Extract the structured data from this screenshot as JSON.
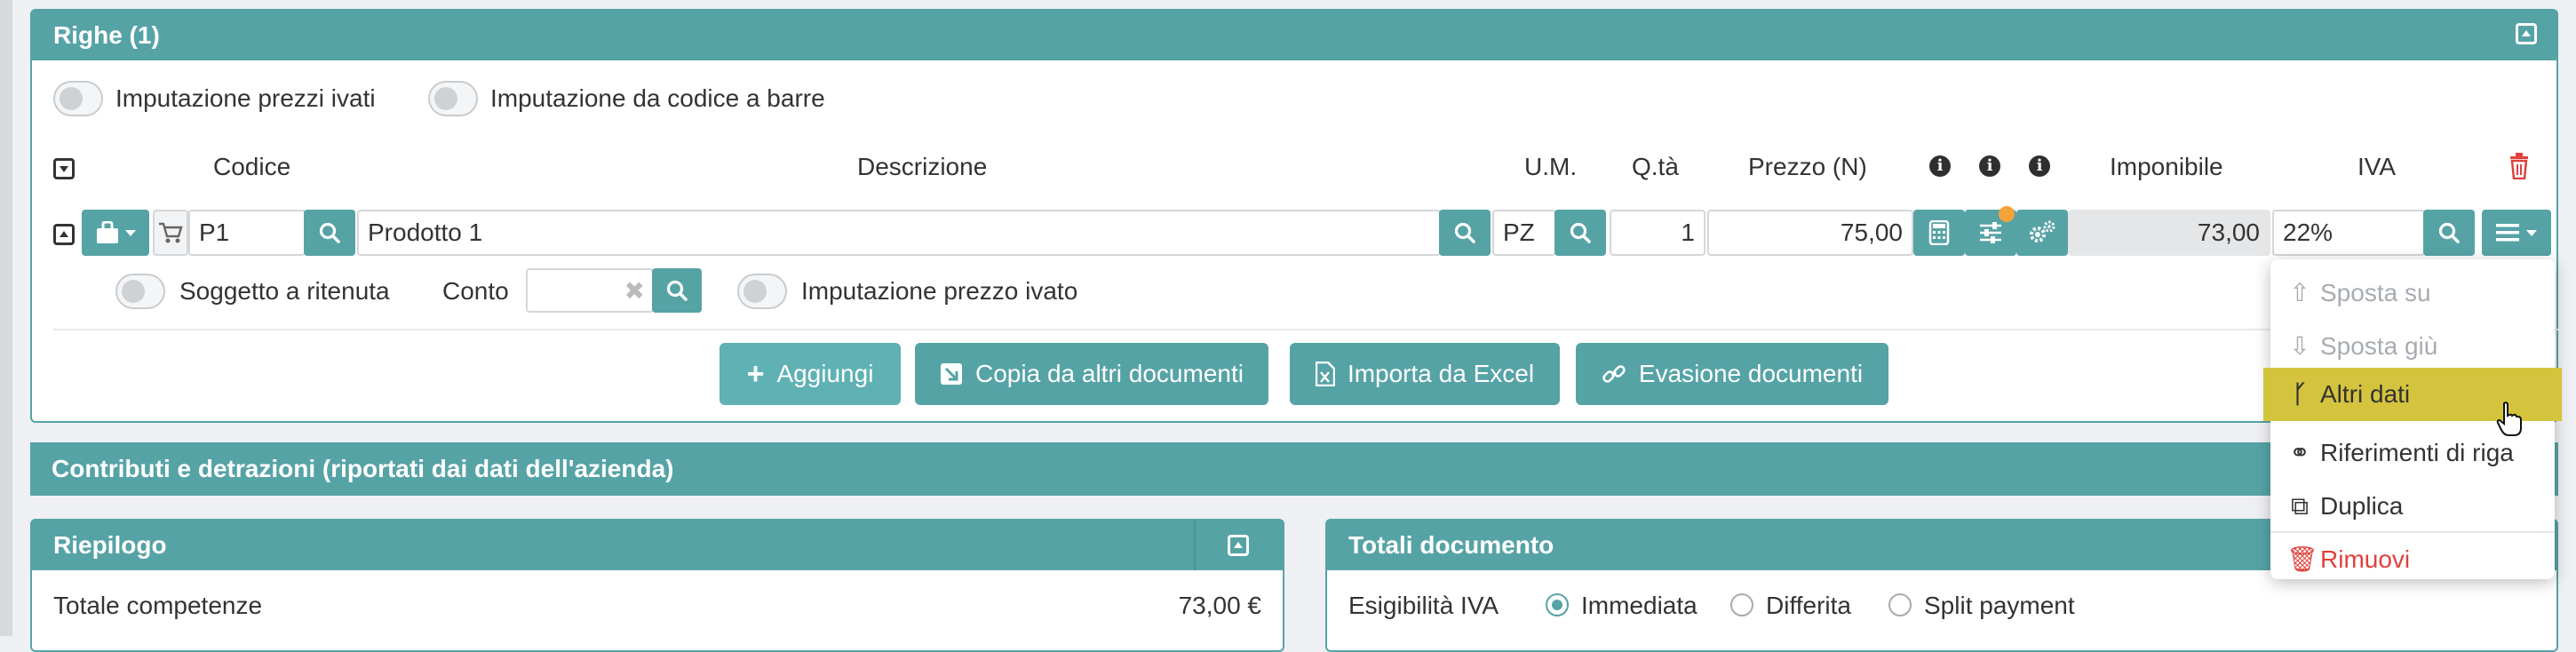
{
  "righe": {
    "title": "Righe (1)",
    "toggle_ivati": "Imputazione prezzi ivati",
    "toggle_barcode": "Imputazione da codice a barre",
    "columns": {
      "codice": "Codice",
      "descrizione": "Descrizione",
      "um": "U.M.",
      "qta": "Q.tà",
      "prezzo": "Prezzo (N)",
      "imponibile": "Imponibile",
      "iva": "IVA"
    },
    "row": {
      "codice": "P1",
      "descrizione": "Prodotto 1",
      "um": "PZ",
      "qta": "1",
      "prezzo": "75,00",
      "imponibile": "73,00",
      "iva": "22%"
    },
    "sub": {
      "ritenuta_label": "Soggetto a ritenuta",
      "conto_label": "Conto",
      "prezzo_ivato_label": "Imputazione prezzo ivato"
    },
    "actions": {
      "aggiungi": "Aggiungi",
      "copia": "Copia da altri documenti",
      "importa": "Importa da Excel",
      "evasione": "Evasione documenti"
    },
    "menu": {
      "sposta_su": "Sposta su",
      "sposta_giu": "Sposta giù",
      "altri_dati": "Altri dati",
      "riferimenti": "Riferimenti di riga",
      "duplica": "Duplica",
      "rimuovi": "Rimuovi"
    }
  },
  "contributi": {
    "title": "Contributi e detrazioni (riportati dai dati dell'azienda)"
  },
  "riepilogo": {
    "title": "Riepilogo",
    "totale_competenze_label": "Totale competenze",
    "totale_competenze_value": "73,00 €"
  },
  "totali": {
    "title": "Totali documento",
    "esigibilita_label": "Esigibilità IVA",
    "options": [
      "Immediata",
      "Differita",
      "Split payment"
    ],
    "selected": "Immediata"
  },
  "colors": {
    "teal": "#56a3a6",
    "danger": "#e0413d",
    "highlight": "#d4c43d"
  }
}
